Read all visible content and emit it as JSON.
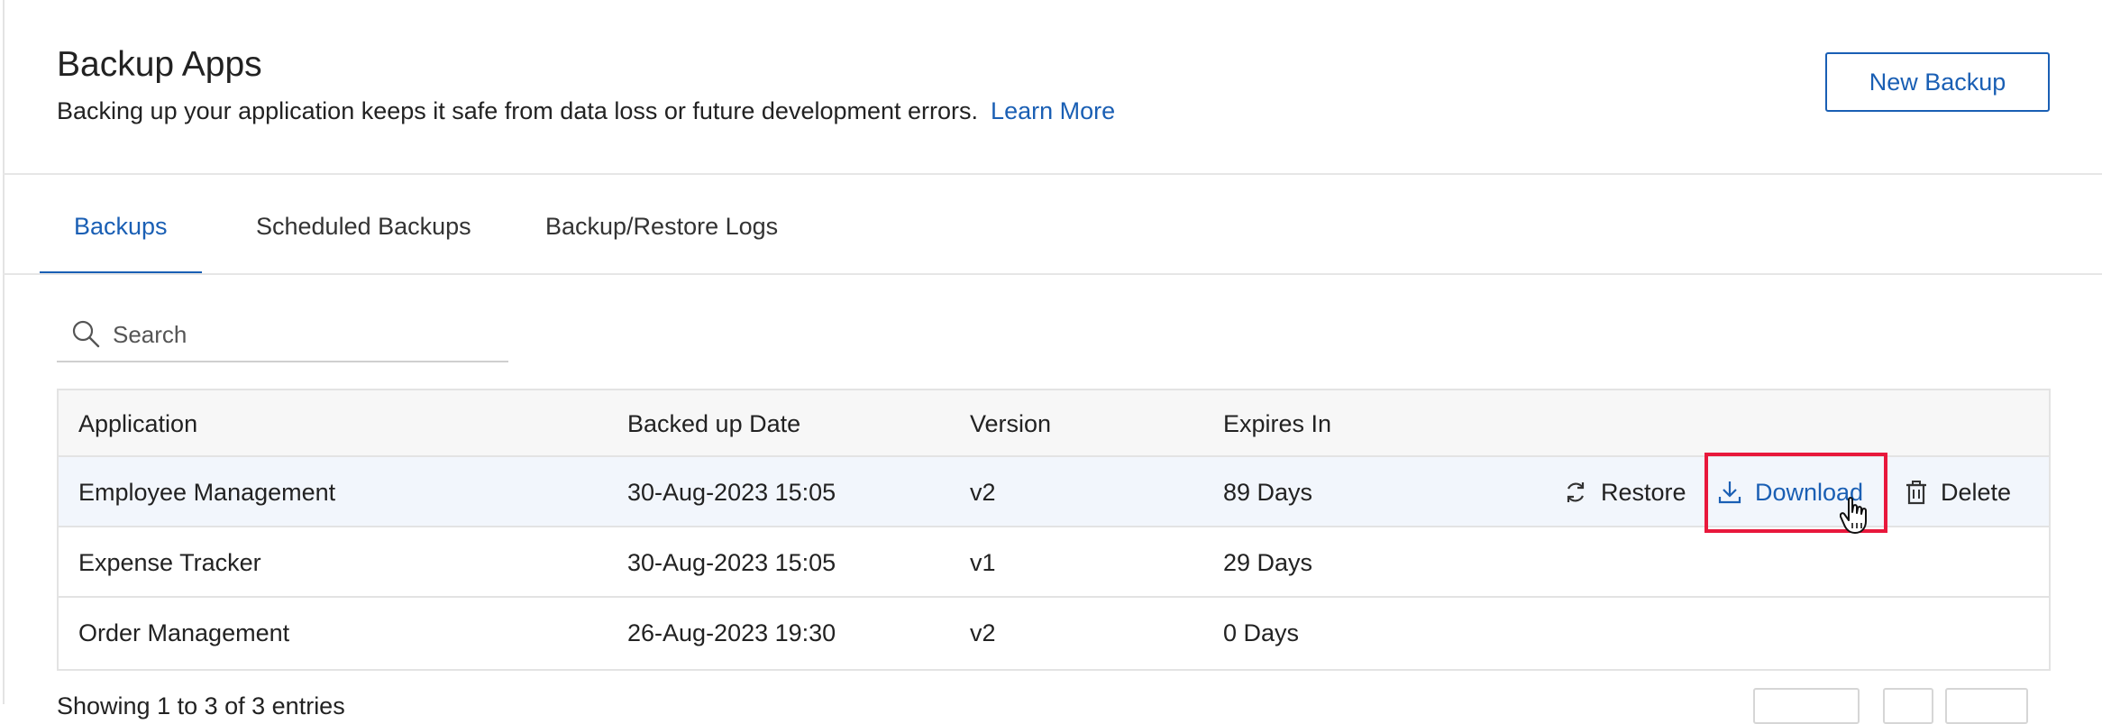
{
  "header": {
    "title": "Backup Apps",
    "description": "Backing up your application keeps it safe from data loss or future development errors.",
    "learn_more": "Learn More",
    "new_backup_label": "New Backup"
  },
  "tabs": [
    {
      "label": "Backups",
      "active": true
    },
    {
      "label": "Scheduled Backups",
      "active": false
    },
    {
      "label": "Backup/Restore Logs",
      "active": false
    }
  ],
  "search": {
    "placeholder": "Search",
    "value": ""
  },
  "table": {
    "columns": [
      "Application",
      "Backed up Date",
      "Version",
      "Expires In"
    ],
    "rows": [
      {
        "application": "Employee Management",
        "date": "30-Aug-2023 15:05",
        "version": "v2",
        "expires": "89  Days"
      },
      {
        "application": "Expense Tracker",
        "date": "30-Aug-2023 15:05",
        "version": "v1",
        "expires": "29  Days"
      },
      {
        "application": "Order Management",
        "date": "26-Aug-2023 19:30",
        "version": "v2",
        "expires": "0  Days"
      }
    ],
    "row_actions": {
      "restore": "Restore",
      "download": "Download",
      "delete": "Delete"
    }
  },
  "footer": {
    "showing_text": "Showing 1 to 3 of 3 entries"
  },
  "icons": [
    "search-icon",
    "refresh-icon",
    "download-icon",
    "trash-icon",
    "hand-cursor-icon"
  ],
  "colors": {
    "accent": "#1a5fb4",
    "highlight": "#e8183c",
    "row_hover": "#f2f6fc"
  }
}
